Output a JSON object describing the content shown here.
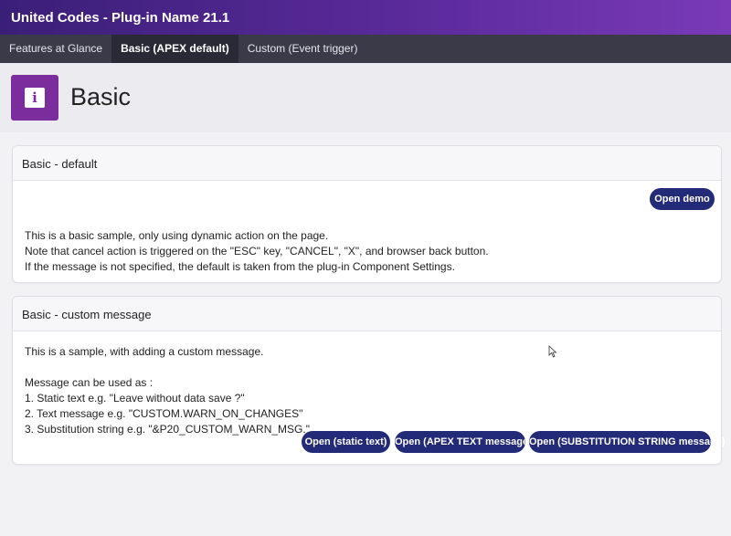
{
  "app": {
    "title": "United Codes - Plug-in Name 21.1"
  },
  "nav": {
    "tabs": [
      {
        "label": "Features at Glance"
      },
      {
        "label": "Basic (APEX default)"
      },
      {
        "label": "Custom (Event trigger)"
      }
    ]
  },
  "hero": {
    "icon": "info-icon",
    "icon_glyph": "i",
    "title": "Basic"
  },
  "card1": {
    "title": "Basic - default",
    "button": "Open demo",
    "lines": [
      "This is a basic sample, only using dynamic action on the page.",
      "Note that cancel action is triggered on the \"ESC\" key, \"CANCEL\", \"X\", and browser back button.",
      "If the message is not specified, the default is taken from the plug-in Component Settings."
    ]
  },
  "card2": {
    "title": "Basic - custom message",
    "lines": [
      "This is a sample, with adding a custom message.",
      "Message can be used as :",
      "1. Static text e.g. \"Leave without data save ?\"",
      "2. Text message e.g. \"CUSTOM.WARN_ON_CHANGES\"",
      "3. Substitution string e.g. \"&P20_CUSTOM_WARN_MSG.\""
    ],
    "buttons": [
      {
        "label": "Open (static text)"
      },
      {
        "label": "Open (APEX TEXT message)"
      },
      {
        "label": "Open (SUBSTITUTION STRING message)"
      }
    ]
  },
  "colors": {
    "accent": "#232a78",
    "badge": "#7b2d9e"
  }
}
